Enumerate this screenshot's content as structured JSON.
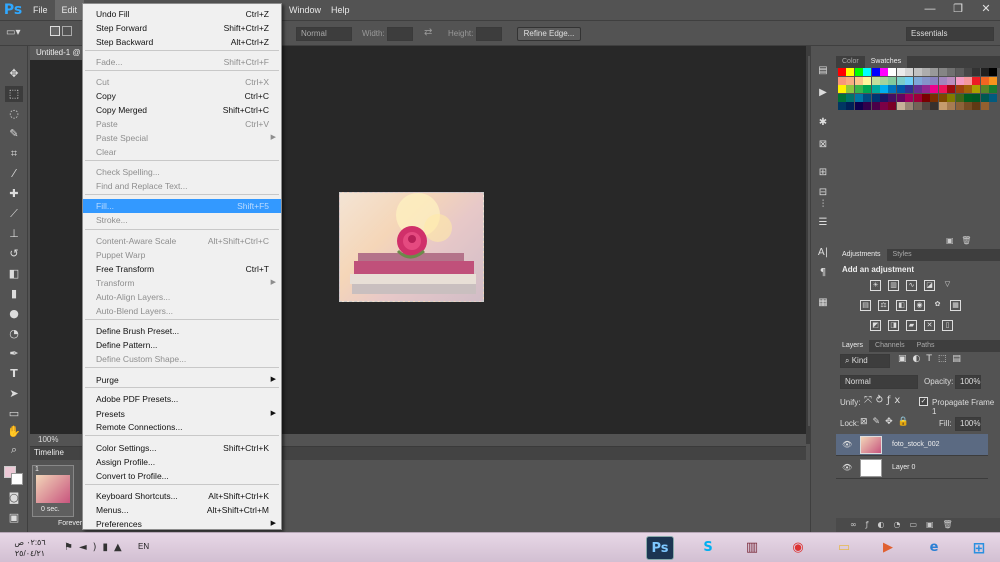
{
  "app": {
    "logo": "Ps"
  },
  "menubar": {
    "items": [
      "File",
      "Edit",
      "Window",
      "Help"
    ]
  },
  "window_controls": {
    "min": "—",
    "max": "❐",
    "close": "✕"
  },
  "options": {
    "style_value": "Normal",
    "width_label": "Width:",
    "height_label": "Height:",
    "refine_edge": "Refine Edge...",
    "workspace": "Essentials"
  },
  "document": {
    "tab_title": "Untitled-1 @",
    "zoom": "100%"
  },
  "edit_menu": {
    "items": [
      {
        "label": "Undo Fill",
        "shortcut": "Ctrl+Z"
      },
      {
        "label": "Step Forward",
        "shortcut": "Shift+Ctrl+Z"
      },
      {
        "label": "Step Backward",
        "shortcut": "Alt+Ctrl+Z"
      },
      {
        "label": "Fade...",
        "shortcut": "Shift+Ctrl+F"
      },
      {
        "label": "Cut",
        "shortcut": "Ctrl+X"
      },
      {
        "label": "Copy",
        "shortcut": "Ctrl+C"
      },
      {
        "label": "Copy Merged",
        "shortcut": "Shift+Ctrl+C"
      },
      {
        "label": "Paste",
        "shortcut": "Ctrl+V"
      },
      {
        "label": "Paste Special",
        "shortcut": ""
      },
      {
        "label": "Clear",
        "shortcut": ""
      },
      {
        "label": "Check Spelling...",
        "shortcut": ""
      },
      {
        "label": "Find and Replace Text...",
        "shortcut": ""
      },
      {
        "label": "Fill...",
        "shortcut": "Shift+F5"
      },
      {
        "label": "Stroke...",
        "shortcut": ""
      },
      {
        "label": "Content-Aware Scale",
        "shortcut": "Alt+Shift+Ctrl+C"
      },
      {
        "label": "Puppet Warp",
        "shortcut": ""
      },
      {
        "label": "Free Transform",
        "shortcut": "Ctrl+T"
      },
      {
        "label": "Transform",
        "shortcut": ""
      },
      {
        "label": "Auto-Align Layers...",
        "shortcut": ""
      },
      {
        "label": "Auto-Blend Layers...",
        "shortcut": ""
      },
      {
        "label": "Define Brush Preset...",
        "shortcut": ""
      },
      {
        "label": "Define Pattern...",
        "shortcut": ""
      },
      {
        "label": "Define Custom Shape...",
        "shortcut": ""
      },
      {
        "label": "Purge",
        "shortcut": ""
      },
      {
        "label": "Adobe PDF Presets...",
        "shortcut": ""
      },
      {
        "label": "Presets",
        "shortcut": ""
      },
      {
        "label": "Remote Connections...",
        "shortcut": ""
      },
      {
        "label": "Color Settings...",
        "shortcut": "Shift+Ctrl+K"
      },
      {
        "label": "Assign Profile...",
        "shortcut": ""
      },
      {
        "label": "Convert to Profile...",
        "shortcut": ""
      },
      {
        "label": "Keyboard Shortcuts...",
        "shortcut": "Alt+Shift+Ctrl+K"
      },
      {
        "label": "Menus...",
        "shortcut": "Alt+Shift+Ctrl+M"
      },
      {
        "label": "Preferences",
        "shortcut": ""
      }
    ]
  },
  "timeline": {
    "title": "Timeline",
    "frame_number": "1",
    "frame_delay": "0 sec.",
    "loop": "Forever"
  },
  "panels": {
    "color_tab": "Color",
    "swatches_tab": "Swatches",
    "adjustments_tab": "Adjustments",
    "styles_tab": "Styles",
    "add_adjustment": "Add an adjustment",
    "layers_tab": "Layers",
    "channels_tab": "Channels",
    "paths_tab": "Paths",
    "kind_filter": "Kind",
    "blend_mode": "Normal",
    "opacity_label": "Opacity:",
    "opacity_value": "100%",
    "unify_label": "Unify:",
    "propagate": "Propagate Frame 1",
    "lock_label": "Lock:",
    "fill_label": "Fill:",
    "fill_value": "100%",
    "layers": [
      {
        "name": "foto_stock_002"
      },
      {
        "name": "Layer 0"
      }
    ]
  },
  "swatch_colors": [
    "#ff0000",
    "#ffff00",
    "#00ff00",
    "#00ffff",
    "#0000ff",
    "#ff00ff",
    "#ffffff",
    "#ebebeb",
    "#d6d6d6",
    "#c2c2c2",
    "#adadad",
    "#999999",
    "#858585",
    "#707070",
    "#5c5c5c",
    "#474747",
    "#333333",
    "#1f1f1f",
    "#000000",
    "#f7977a",
    "#f9ad81",
    "#fdc68a",
    "#fff79a",
    "#c4df9b",
    "#a3d39c",
    "#82ca9d",
    "#7bcdc8",
    "#6ecff6",
    "#7ea7d8",
    "#8493ca",
    "#8882be",
    "#a187be",
    "#bc8dbf",
    "#f49ac2",
    "#f6989d",
    "#ed1c24",
    "#f26522",
    "#f7941d",
    "#fff200",
    "#8dc63f",
    "#39b54a",
    "#00a651",
    "#00a99d",
    "#00aeef",
    "#0072bc",
    "#0054a6",
    "#2e3192",
    "#662d91",
    "#92278f",
    "#ec008c",
    "#ed145b",
    "#9e0b0f",
    "#a0410d",
    "#a36209",
    "#aba000",
    "#598527",
    "#1a7b30",
    "#007236",
    "#00746b",
    "#0076a3",
    "#004b80",
    "#003471",
    "#1b1464",
    "#440e62",
    "#630460",
    "#9e005d",
    "#9e0039",
    "#790000",
    "#7b2e00",
    "#7d4900",
    "#827b00",
    "#406618",
    "#005e20",
    "#005826",
    "#005952",
    "#005b7f",
    "#003663",
    "#002157",
    "#0d004c",
    "#32004b",
    "#4b0049",
    "#7b0046",
    "#7a0026",
    "#c7b299",
    "#998675",
    "#736357",
    "#534741",
    "#37302d",
    "#c69c6d",
    "#a67c52",
    "#8c6239",
    "#754c24",
    "#603913",
    "#92602f"
  ],
  "taskbar": {
    "clock_time": "٠٢:٥٦ ص",
    "clock_date": "٢٥/٠٤/٢١",
    "language": "EN"
  }
}
